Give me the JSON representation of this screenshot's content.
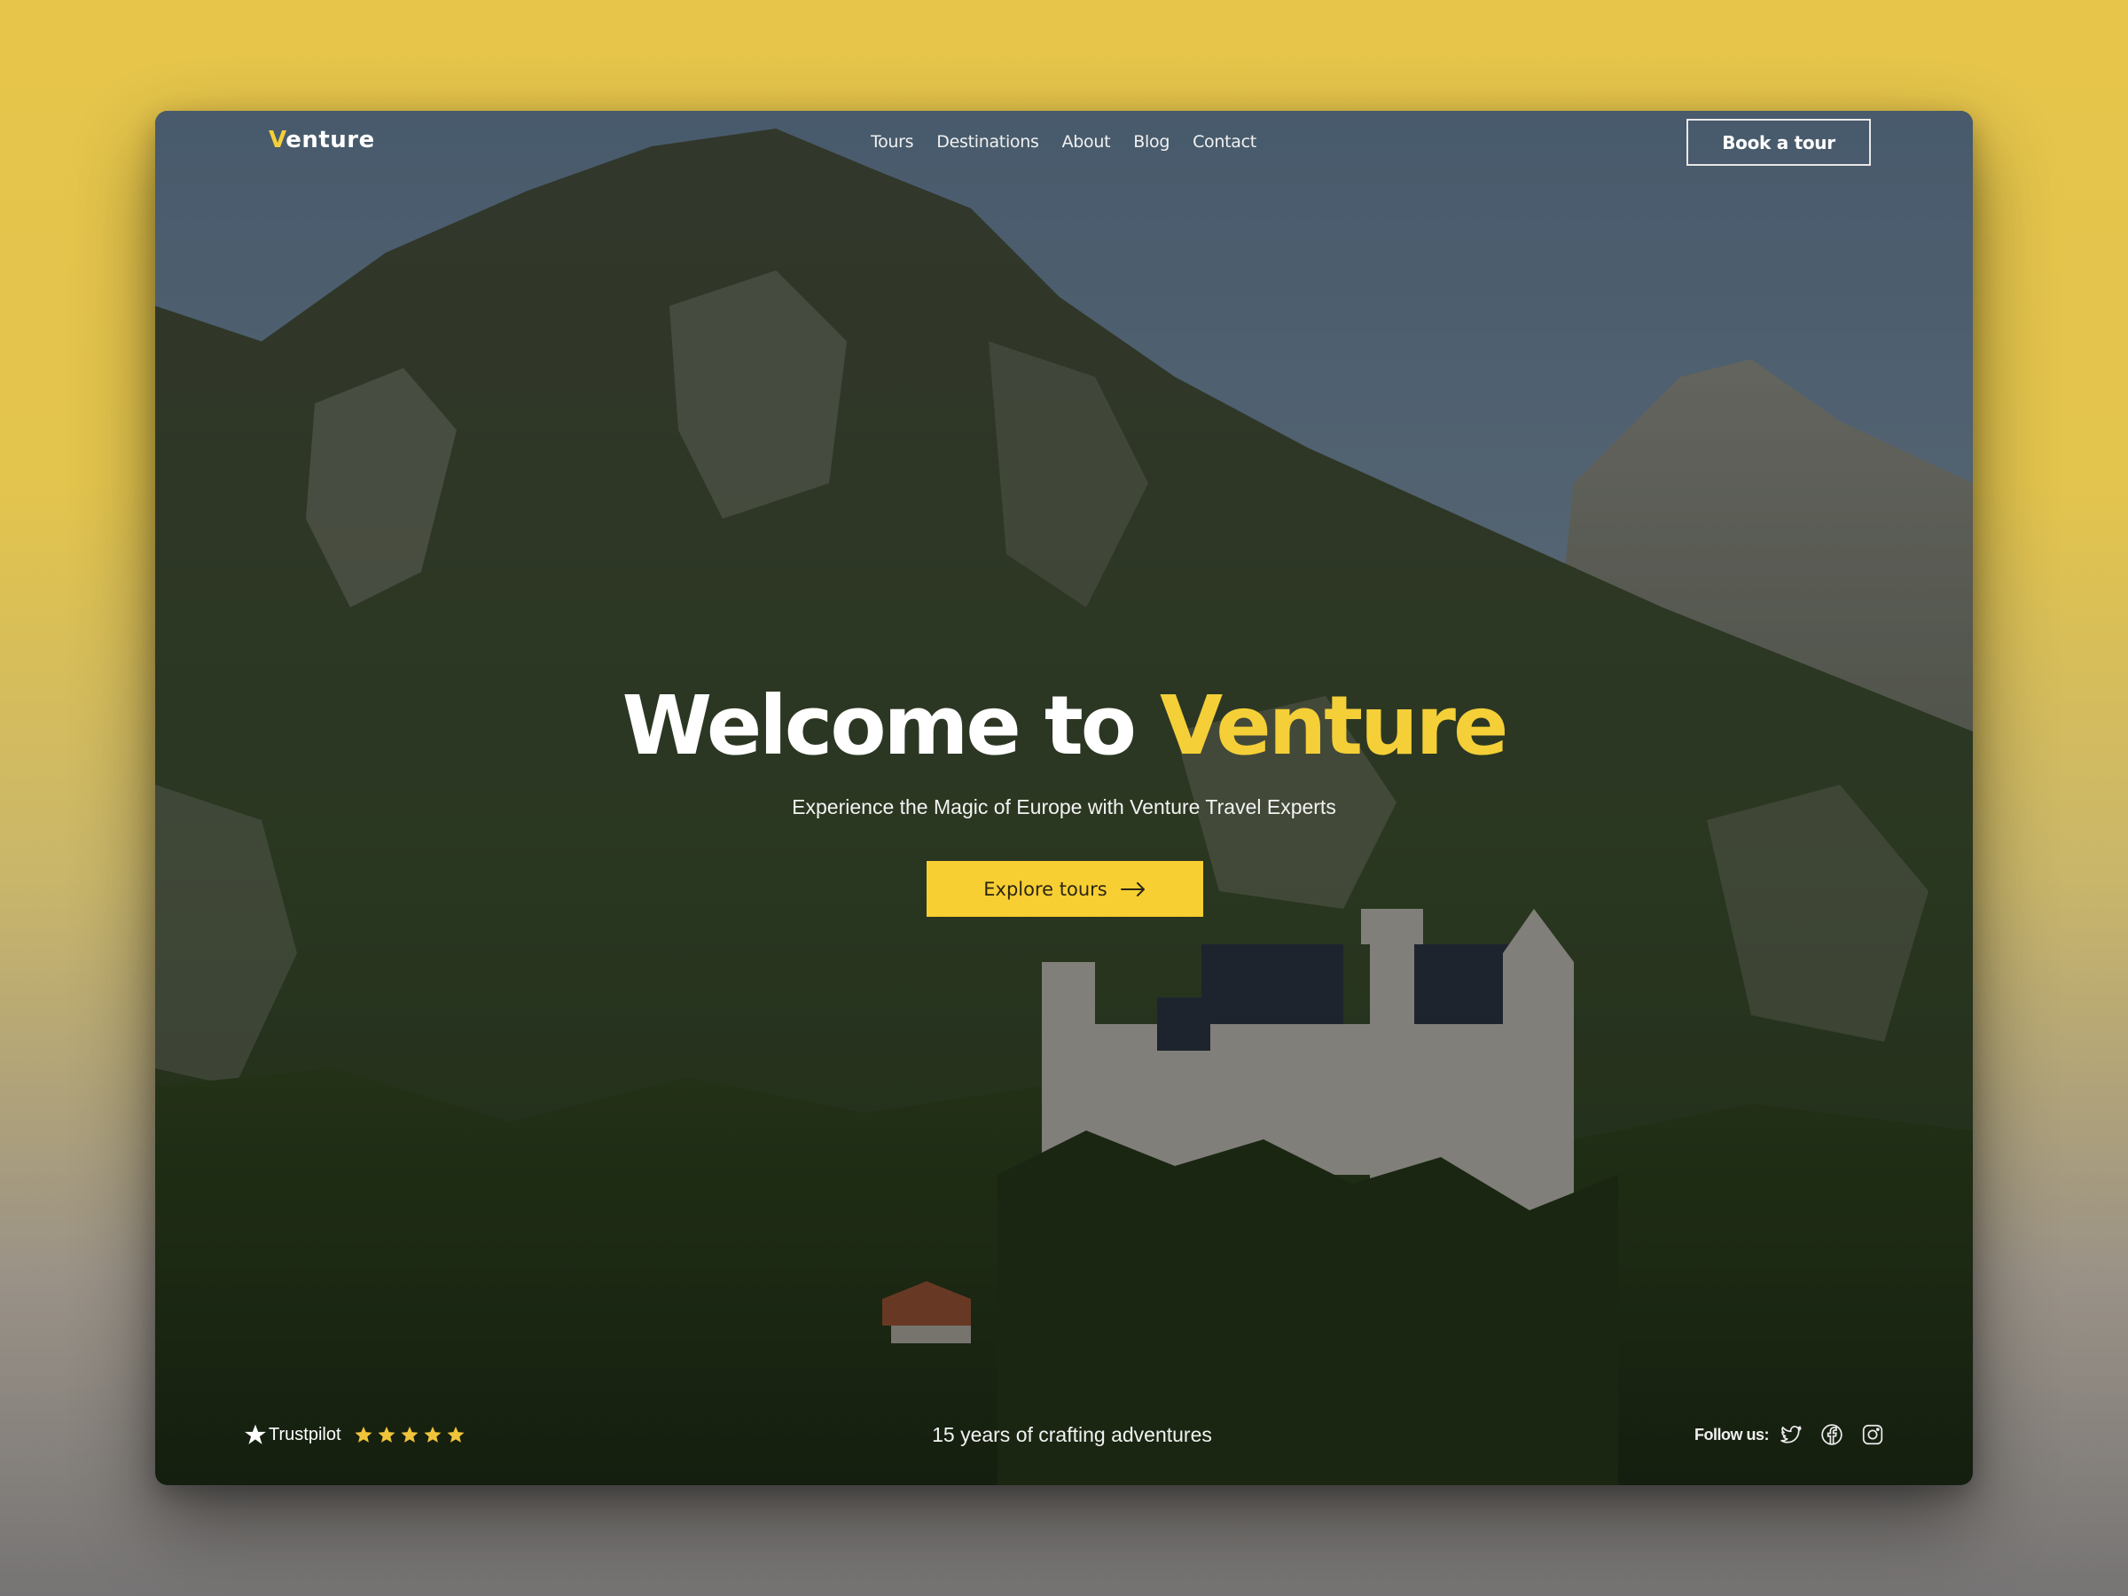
{
  "brand": {
    "logo_initial": "V",
    "logo_rest": "enture",
    "accent_color": "#f4cf38"
  },
  "nav": {
    "items": [
      {
        "label": "Tours"
      },
      {
        "label": "Destinations"
      },
      {
        "label": "About"
      },
      {
        "label": "Blog"
      },
      {
        "label": "Contact"
      }
    ],
    "book_button": "Book a tour"
  },
  "hero": {
    "title_prefix": "Welcome to ",
    "title_highlight": "Venture",
    "subtitle": "Experience the Magic of Europe with Venture Travel Experts",
    "cta_label": "Explore tours",
    "cta_icon": "arrow-right-icon",
    "background_image": "Mountain forest landscape with fairytale castle"
  },
  "footer": {
    "trustpilot": {
      "label": "Trustpilot",
      "rating": 5,
      "max_rating": 5,
      "star_color": "#f0c43a"
    },
    "tagline": "15 years of crafting adventures",
    "follow_label": "Follow us:",
    "social": [
      {
        "icon": "twitter-icon"
      },
      {
        "icon": "facebook-icon"
      },
      {
        "icon": "instagram-icon"
      }
    ]
  }
}
